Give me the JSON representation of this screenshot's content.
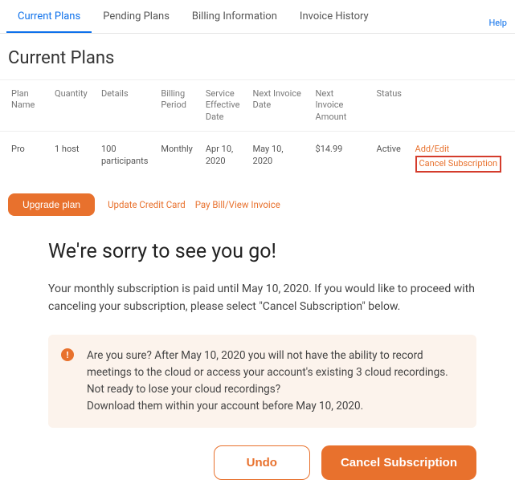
{
  "tabs": {
    "current": "Current Plans",
    "pending": "Pending Plans",
    "billing": "Billing Information",
    "invoice": "Invoice History",
    "help": "Help"
  },
  "page_title": "Current Plans",
  "table": {
    "headers": {
      "plan_name": "Plan Name",
      "quantity": "Quantity",
      "details": "Details",
      "billing_period": "Billing Period",
      "effective_date": "Service Effective Date",
      "next_invoice_date": "Next Invoice Date",
      "next_invoice_amount": "Next Invoice Amount",
      "status": "Status"
    },
    "row": {
      "plan_name": "Pro",
      "quantity": "1 host",
      "details": "100 participants",
      "billing_period": "Monthly",
      "effective_date": "Apr 10, 2020",
      "next_invoice_date": "May 10, 2020",
      "next_invoice_amount": "$14.99",
      "status": "Active",
      "add_edit": "Add/Edit",
      "cancel_subscription": "Cancel Subscription"
    }
  },
  "actions": {
    "upgrade": "Upgrade plan",
    "update_card": "Update Credit Card",
    "pay_bill": "Pay Bill/View Invoice"
  },
  "cancel": {
    "title": "We're sorry to see you go!",
    "desc": "Your monthly subscription is paid until May 10, 2020. If you would like to proceed with canceling your subscription, please select \"Cancel Subscription\" below.",
    "warning": "Are you sure? After May 10, 2020 you will not have the ability to record meetings to the cloud or access your account's existing 3 cloud recordings. Not ready to lose your cloud recordings?\nDownload them within your account before May 10, 2020.",
    "undo": "Undo",
    "cancel_btn": "Cancel Subscription"
  }
}
